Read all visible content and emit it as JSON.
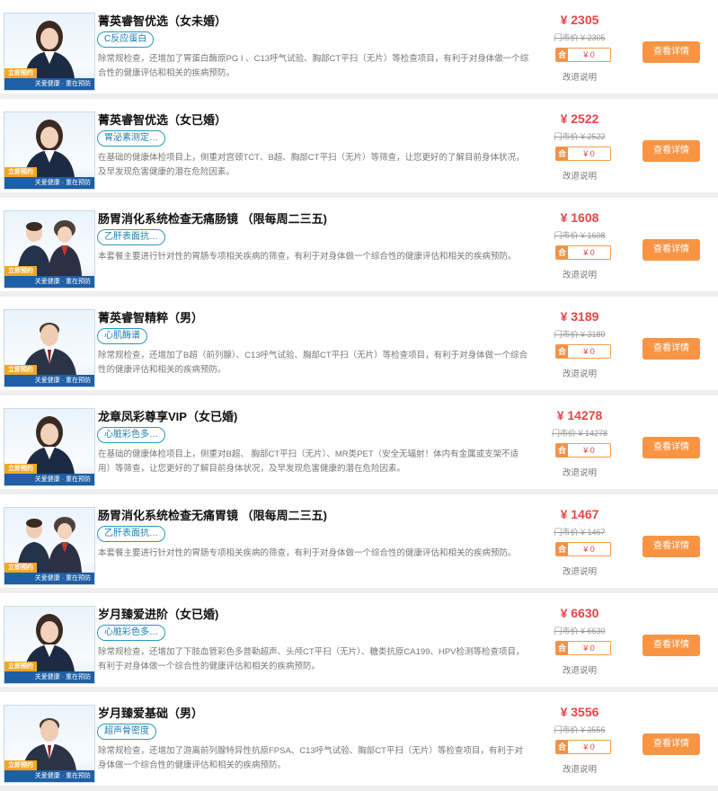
{
  "thumb_text": {
    "badge": "立即预约",
    "band": "关爱健康 · 重在预防"
  },
  "colors": {
    "price": "#e94545",
    "button": "#f79545",
    "tag_border": "#2b97c5",
    "coupon": "#f0914a"
  },
  "items": [
    {
      "title": "菁英睿智优选（女未婚）",
      "tag": "C反应蛋白",
      "desc": "除常规检查，还增加了胃蛋白酶原PG I 、C13呼气试验、胸部CT平扫（无片）等检查项目，有利于对身体做一个综合性的健康评估和相关的疾病预防。",
      "price": "¥ 2305",
      "market": "门市价 ¥ 2305",
      "coupon_icon": "合",
      "coupon_value": "¥ 0",
      "refund": "改退说明",
      "button": "查看详情",
      "figure": "woman"
    },
    {
      "title": "菁英睿智优选（女已婚）",
      "tag": "胃泌素测定…",
      "desc": "在基础的健康体检项目上，侧重对宫颈TCT、B超、胸部CT平扫（无片）等筛查，让您更好的了解目前身体状况，及早发现危害健康的潜在危险因素。",
      "price": "¥ 2522",
      "market": "门市价 ¥ 2522",
      "coupon_icon": "合",
      "coupon_value": "¥ 0",
      "refund": "改退说明",
      "button": "查看详情",
      "figure": "woman"
    },
    {
      "title": "肠胃消化系统检查无痛肠镜 （限每周二三五)",
      "tag": "乙肝表面抗…",
      "desc": "本套餐主要进行针对性的胃肠专项相关疾病的筛查，有利于对身体做一个综合性的健康评估和相关的疾病预防。",
      "price": "¥ 1608",
      "market": "门市价 ¥ 1608",
      "coupon_icon": "合",
      "coupon_value": "¥ 0",
      "refund": "改退说明",
      "button": "查看详情",
      "figure": "pair"
    },
    {
      "title": "菁英睿智精粹（男）",
      "tag": "心肌酶谱",
      "desc": "除常规检查，还增加了B超（前列腺）、C13呼气试验、胸部CT平扫（无片）等检查项目，有利于对身体做一个综合性的健康评估和相关的疾病预防。",
      "price": "¥ 3189",
      "market": "门市价 ¥ 3189",
      "coupon_icon": "合",
      "coupon_value": "¥ 0",
      "refund": "改退说明",
      "button": "查看详情",
      "figure": "man"
    },
    {
      "title": "龙章凤彩尊享VIP（女已婚)",
      "tag": "心脏彩色多…",
      "desc": "在基础的健康体检项目上，侧重对B超、 胸部CT平扫（无片）、MR类PET（安全无辐射！体内有金属或支架不适用）等筛查，让您更好的了解目前身体状况，及早发现危害健康的潜在危险因素。",
      "price": "¥ 14278",
      "market": "门市价 ¥ 14278",
      "coupon_icon": "合",
      "coupon_value": "¥ 0",
      "refund": "改退说明",
      "button": "查看详情",
      "figure": "woman"
    },
    {
      "title": "肠胃消化系统检查无痛胃镜 （限每周二三五)",
      "tag": "乙肝表面抗…",
      "desc": "本套餐主要进行针对性的胃肠专项相关疾病的筛查，有利于对身体做一个综合性的健康评估和相关的疾病预防。",
      "price": "¥ 1467",
      "market": "门市价 ¥ 1467",
      "coupon_icon": "合",
      "coupon_value": "¥ 0",
      "refund": "改退说明",
      "button": "查看详情",
      "figure": "pair"
    },
    {
      "title": "岁月臻爱进阶（女已婚)",
      "tag": "心脏彩色多…",
      "desc": "除常规检查，还增加了下肢血管彩色多普勒超声、头颅CT平扫（无片）、糖类抗原CA199、HPV检测等检查项目，有利于对身体做一个综合性的健康评估和相关的疾病预防。",
      "price": "¥ 6630",
      "market": "门市价 ¥ 6630",
      "coupon_icon": "合",
      "coupon_value": "¥ 0",
      "refund": "改退说明",
      "button": "查看详情",
      "figure": "woman"
    },
    {
      "title": "岁月臻爱基础（男）",
      "tag": "超声骨密度",
      "desc": "除常规检查，还增加了游离前列腺特异性抗原FPSA、C13呼气试验、胸部CT平扫（无片）等检查项目，有利于对身体做一个综合性的健康评估和相关的疾病预防。",
      "price": "¥ 3556",
      "market": "门市价 ¥ 3556",
      "coupon_icon": "合",
      "coupon_value": "¥ 0",
      "refund": "改退说明",
      "button": "查看详情",
      "figure": "man"
    }
  ]
}
